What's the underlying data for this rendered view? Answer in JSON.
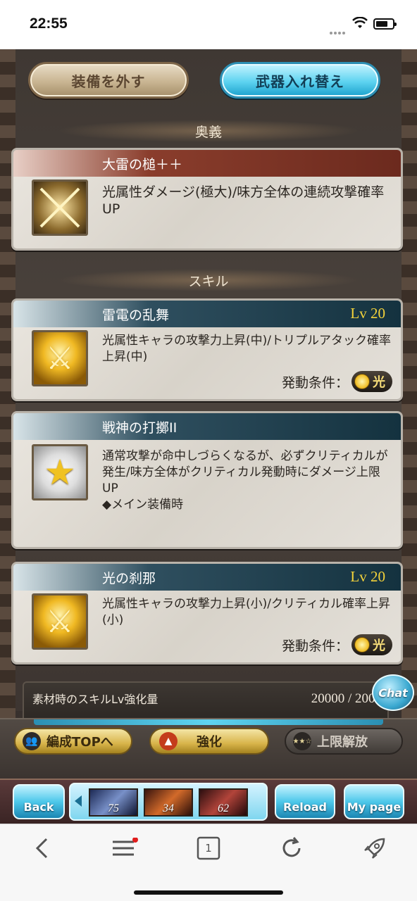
{
  "status_bar": {
    "time": "22:55"
  },
  "top_buttons": {
    "unequip": "装備を外す",
    "swap": "武器入れ替え"
  },
  "ougi_section": {
    "title": "奥義"
  },
  "ougi": {
    "name": "大雷の槌＋＋",
    "description": "光属性ダメージ(極大)/味方全体の連続攻撃確率UP"
  },
  "skills_section": {
    "title": "スキル"
  },
  "skills": [
    {
      "name": "雷電の乱舞",
      "level": "Lv 20",
      "description": "光属性キャラの攻撃力上昇(中)/トリプルアタック確率上昇(中)",
      "condition_label": "発動条件：",
      "condition_element": "光"
    },
    {
      "name": "戦神の打擲II",
      "description": "通常攻撃が命中しづらくなるが、必ずクリティカルが発生/味方全体がクリティカル発動時にダメージ上限UP",
      "note": "◆メイン装備時"
    },
    {
      "name": "光の刹那",
      "level": "Lv 20",
      "description": "光属性キャラの攻撃力上昇(小)/クリティカル確率上昇(小)",
      "condition_label": "発動条件：",
      "condition_element": "光"
    }
  ],
  "material": {
    "label": "素材時のスキルLv強化量",
    "value": "20000 / 2000"
  },
  "chat": {
    "label": "Chat"
  },
  "actions": {
    "party_top": "編成TOPへ",
    "upgrade": "強化",
    "limit_break": "上限解放"
  },
  "game_nav": {
    "back": "Back",
    "reload": "Reload",
    "mypage": "My page",
    "party_levels": [
      "75",
      "34",
      "62"
    ]
  },
  "browser": {
    "tab_count": "1"
  },
  "colors": {
    "accent_blue": "#4dc8ea",
    "level_yellow": "#f4d33a",
    "ougi_header": "#6c2a1e",
    "skill_header": "#14323f"
  }
}
